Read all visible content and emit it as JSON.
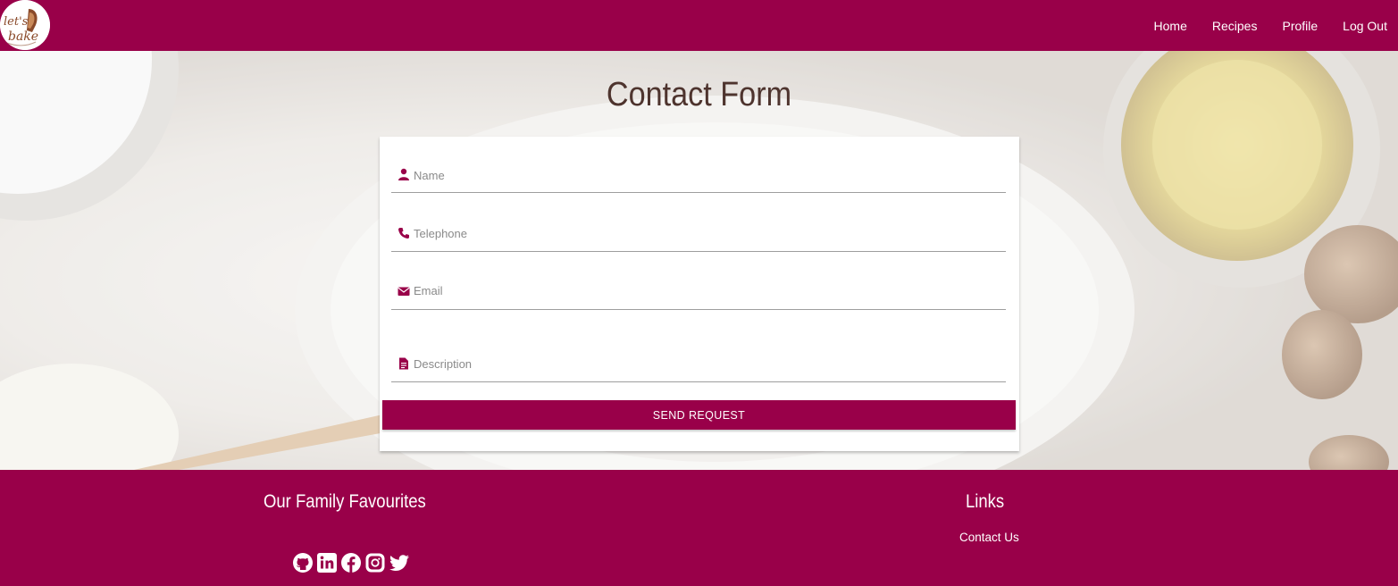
{
  "navbar": {
    "logo_text": "let's bake",
    "links": [
      "Home",
      "Recipes",
      "Profile",
      "Log Out"
    ]
  },
  "hero": {
    "title": "Contact Form"
  },
  "form": {
    "name_placeholder": "Name",
    "telephone_placeholder": "Telephone",
    "email_placeholder": "Email",
    "description_placeholder": "Description",
    "submit_label": "SEND REQUEST"
  },
  "footer": {
    "favourites_heading": "Our Family Favourites",
    "links_heading": "Links",
    "contact_link": "Contact Us",
    "social_icons": [
      "github-icon",
      "linkedin-icon",
      "facebook-icon",
      "instagram-icon",
      "twitter-icon"
    ]
  },
  "colors": {
    "brand": "#990049",
    "title": "#4e342e"
  }
}
